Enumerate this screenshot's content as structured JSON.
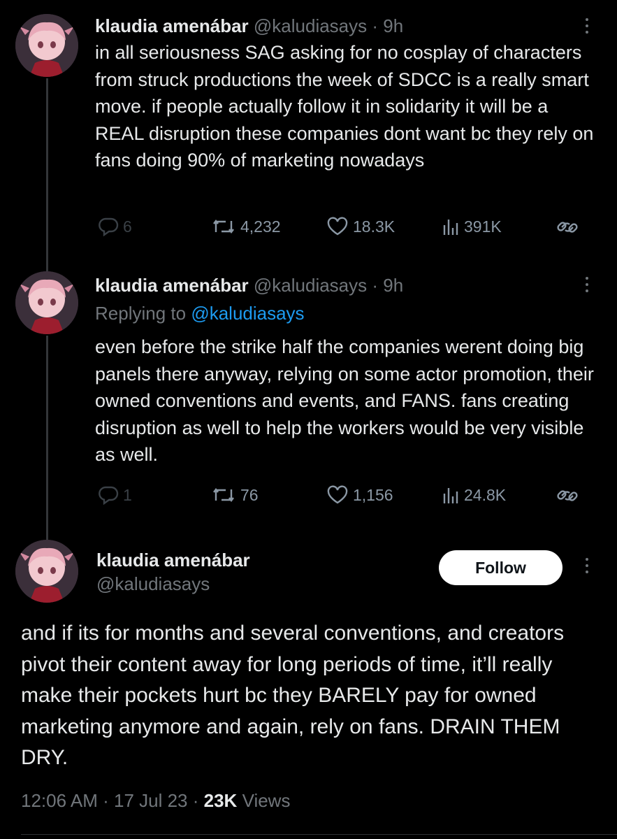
{
  "tweets": [
    {
      "display_name": "klaudia amenábar",
      "handle": "@kaludiasays",
      "time": "· 9h",
      "text": "in all seriousness SAG asking for no cosplay of characters from struck productions the week of SDCC is a really smart move. if people actually follow it in solidarity it will be a REAL disruption these companies dont want bc they rely on fans doing 90% of marketing nowadays",
      "replies": "6",
      "retweets": "4,232",
      "likes": "18.3K",
      "views": "391K"
    },
    {
      "display_name": "klaudia amenábar",
      "handle": "@kaludiasays",
      "time": "· 9h",
      "replying_prefix": "Replying to",
      "replying_handle": "@kaludiasays",
      "text": "even before the strike half the companies werent doing big panels there anyway, relying on some actor promotion, their owned conventions and events, and FANS. fans creating disruption as well to help the workers would be very visible as well.",
      "replies": "1",
      "retweets": "76",
      "likes": "1,156",
      "views": "24.8K"
    }
  ],
  "main_tweet": {
    "display_name": "klaudia amenábar",
    "handle": "@kaludiasays",
    "follow_label": "Follow",
    "text": "and if its for months and several conventions, and creators pivot their content away for long periods of time, it’ll really make their pockets hurt bc they BARELY pay for owned marketing anymore and again, rely on fans. DRAIN THEM DRY.",
    "time": "12:06 AM",
    "date": "17 Jul 23",
    "views_count": "23K",
    "views_label": "Views"
  },
  "icons": [
    "reply-icon",
    "retweet-icon",
    "like-icon",
    "views-icon",
    "share-icon",
    "more-icon"
  ],
  "colors": {
    "background": "#000000",
    "text": "#e7e9ea",
    "secondary": "#71767b",
    "link": "#1d9bf0",
    "button": "#ffffff"
  }
}
